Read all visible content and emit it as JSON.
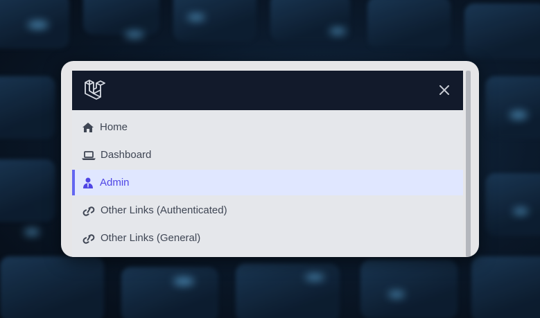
{
  "header": {
    "logo_icon": "laravel-logo-icon",
    "close_icon": "close-icon",
    "background": "#121a2b"
  },
  "nav": {
    "items": [
      {
        "label": "Home",
        "icon": "home-icon",
        "active": false
      },
      {
        "label": "Dashboard",
        "icon": "laptop-icon",
        "active": false
      },
      {
        "label": "Admin",
        "icon": "user-icon",
        "active": true
      },
      {
        "label": "Other Links (Authenticated)",
        "icon": "link-icon",
        "active": false
      },
      {
        "label": "Other Links (General)",
        "icon": "link-icon",
        "active": false
      }
    ]
  },
  "colors": {
    "active_text": "#4f46e5",
    "active_background": "#e0e7ff",
    "active_border": "#6366f1",
    "text": "#3f4654"
  }
}
